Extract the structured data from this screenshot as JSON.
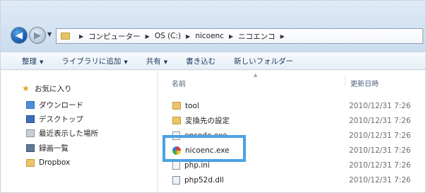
{
  "navigation": {
    "back_icon": "back-arrow-icon",
    "forward_icon": "forward-arrow-icon",
    "dropdown_icon": "chevron-down-icon"
  },
  "address_bar": {
    "crumbs": [
      "コンピューター",
      "OS (C:)",
      "nicoenc",
      "ニコエンコ"
    ]
  },
  "toolbar": {
    "organize": "整理",
    "add_to_library": "ライブラリに追加",
    "share": "共有",
    "burn": "書き込む",
    "new_folder": "新しいフォルダー"
  },
  "sidebar": {
    "favorites": "お気に入り",
    "items": [
      {
        "label": "ダウンロード",
        "icon": "download-folder-icon"
      },
      {
        "label": "デスクトップ",
        "icon": "desktop-icon"
      },
      {
        "label": "最近表示した場所",
        "icon": "recent-places-icon"
      },
      {
        "label": "録画一覧",
        "icon": "video-folder-icon"
      },
      {
        "label": "Dropbox",
        "icon": "folder-icon"
      }
    ]
  },
  "file_list": {
    "columns": {
      "name": "名前",
      "date": "更新日時"
    },
    "rows": [
      {
        "name": "tool",
        "date": "2010/12/31 7:26",
        "icon": "folder-icon"
      },
      {
        "name": "変換先の設定",
        "date": "2010/12/31 7:26",
        "icon": "folder-icon"
      },
      {
        "name": "encode.exe",
        "date": "2010/12/31 7:26",
        "icon": "application-icon"
      },
      {
        "name": "nicoenc.exe",
        "date": "2010/12/31 7:26",
        "icon": "nicoenc-app-icon"
      },
      {
        "name": "php.ini",
        "date": "2010/12/31 7:26",
        "icon": "settings-file-icon"
      },
      {
        "name": "php52d.dll",
        "date": "2010/12/31 7:26",
        "icon": "dll-file-icon"
      }
    ]
  },
  "colors": {
    "highlight": "#4aa2e2",
    "toolbar_text": "#1e3a5c",
    "date_text": "#6d6d6d"
  }
}
